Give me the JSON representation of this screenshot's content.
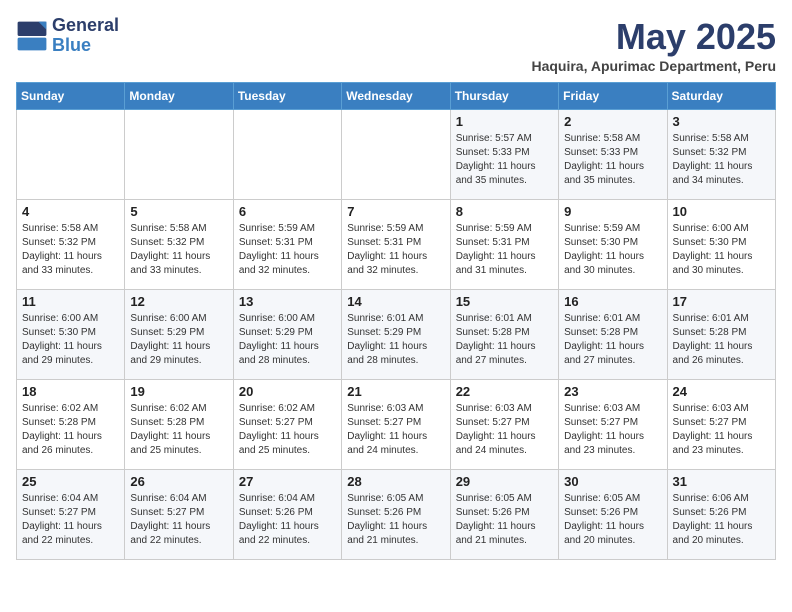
{
  "header": {
    "logo_general": "General",
    "logo_blue": "Blue",
    "month_title": "May 2025",
    "location": "Haquira, Apurimac Department, Peru"
  },
  "days_of_week": [
    "Sunday",
    "Monday",
    "Tuesday",
    "Wednesday",
    "Thursday",
    "Friday",
    "Saturday"
  ],
  "weeks": [
    [
      {
        "day": "",
        "info": ""
      },
      {
        "day": "",
        "info": ""
      },
      {
        "day": "",
        "info": ""
      },
      {
        "day": "",
        "info": ""
      },
      {
        "day": "1",
        "info": "Sunrise: 5:57 AM\nSunset: 5:33 PM\nDaylight: 11 hours and 35 minutes."
      },
      {
        "day": "2",
        "info": "Sunrise: 5:58 AM\nSunset: 5:33 PM\nDaylight: 11 hours and 35 minutes."
      },
      {
        "day": "3",
        "info": "Sunrise: 5:58 AM\nSunset: 5:32 PM\nDaylight: 11 hours and 34 minutes."
      }
    ],
    [
      {
        "day": "4",
        "info": "Sunrise: 5:58 AM\nSunset: 5:32 PM\nDaylight: 11 hours and 33 minutes."
      },
      {
        "day": "5",
        "info": "Sunrise: 5:58 AM\nSunset: 5:32 PM\nDaylight: 11 hours and 33 minutes."
      },
      {
        "day": "6",
        "info": "Sunrise: 5:59 AM\nSunset: 5:31 PM\nDaylight: 11 hours and 32 minutes."
      },
      {
        "day": "7",
        "info": "Sunrise: 5:59 AM\nSunset: 5:31 PM\nDaylight: 11 hours and 32 minutes."
      },
      {
        "day": "8",
        "info": "Sunrise: 5:59 AM\nSunset: 5:31 PM\nDaylight: 11 hours and 31 minutes."
      },
      {
        "day": "9",
        "info": "Sunrise: 5:59 AM\nSunset: 5:30 PM\nDaylight: 11 hours and 30 minutes."
      },
      {
        "day": "10",
        "info": "Sunrise: 6:00 AM\nSunset: 5:30 PM\nDaylight: 11 hours and 30 minutes."
      }
    ],
    [
      {
        "day": "11",
        "info": "Sunrise: 6:00 AM\nSunset: 5:30 PM\nDaylight: 11 hours and 29 minutes."
      },
      {
        "day": "12",
        "info": "Sunrise: 6:00 AM\nSunset: 5:29 PM\nDaylight: 11 hours and 29 minutes."
      },
      {
        "day": "13",
        "info": "Sunrise: 6:00 AM\nSunset: 5:29 PM\nDaylight: 11 hours and 28 minutes."
      },
      {
        "day": "14",
        "info": "Sunrise: 6:01 AM\nSunset: 5:29 PM\nDaylight: 11 hours and 28 minutes."
      },
      {
        "day": "15",
        "info": "Sunrise: 6:01 AM\nSunset: 5:28 PM\nDaylight: 11 hours and 27 minutes."
      },
      {
        "day": "16",
        "info": "Sunrise: 6:01 AM\nSunset: 5:28 PM\nDaylight: 11 hours and 27 minutes."
      },
      {
        "day": "17",
        "info": "Sunrise: 6:01 AM\nSunset: 5:28 PM\nDaylight: 11 hours and 26 minutes."
      }
    ],
    [
      {
        "day": "18",
        "info": "Sunrise: 6:02 AM\nSunset: 5:28 PM\nDaylight: 11 hours and 26 minutes."
      },
      {
        "day": "19",
        "info": "Sunrise: 6:02 AM\nSunset: 5:28 PM\nDaylight: 11 hours and 25 minutes."
      },
      {
        "day": "20",
        "info": "Sunrise: 6:02 AM\nSunset: 5:27 PM\nDaylight: 11 hours and 25 minutes."
      },
      {
        "day": "21",
        "info": "Sunrise: 6:03 AM\nSunset: 5:27 PM\nDaylight: 11 hours and 24 minutes."
      },
      {
        "day": "22",
        "info": "Sunrise: 6:03 AM\nSunset: 5:27 PM\nDaylight: 11 hours and 24 minutes."
      },
      {
        "day": "23",
        "info": "Sunrise: 6:03 AM\nSunset: 5:27 PM\nDaylight: 11 hours and 23 minutes."
      },
      {
        "day": "24",
        "info": "Sunrise: 6:03 AM\nSunset: 5:27 PM\nDaylight: 11 hours and 23 minutes."
      }
    ],
    [
      {
        "day": "25",
        "info": "Sunrise: 6:04 AM\nSunset: 5:27 PM\nDaylight: 11 hours and 22 minutes."
      },
      {
        "day": "26",
        "info": "Sunrise: 6:04 AM\nSunset: 5:27 PM\nDaylight: 11 hours and 22 minutes."
      },
      {
        "day": "27",
        "info": "Sunrise: 6:04 AM\nSunset: 5:26 PM\nDaylight: 11 hours and 22 minutes."
      },
      {
        "day": "28",
        "info": "Sunrise: 6:05 AM\nSunset: 5:26 PM\nDaylight: 11 hours and 21 minutes."
      },
      {
        "day": "29",
        "info": "Sunrise: 6:05 AM\nSunset: 5:26 PM\nDaylight: 11 hours and 21 minutes."
      },
      {
        "day": "30",
        "info": "Sunrise: 6:05 AM\nSunset: 5:26 PM\nDaylight: 11 hours and 20 minutes."
      },
      {
        "day": "31",
        "info": "Sunrise: 6:06 AM\nSunset: 5:26 PM\nDaylight: 11 hours and 20 minutes."
      }
    ]
  ]
}
